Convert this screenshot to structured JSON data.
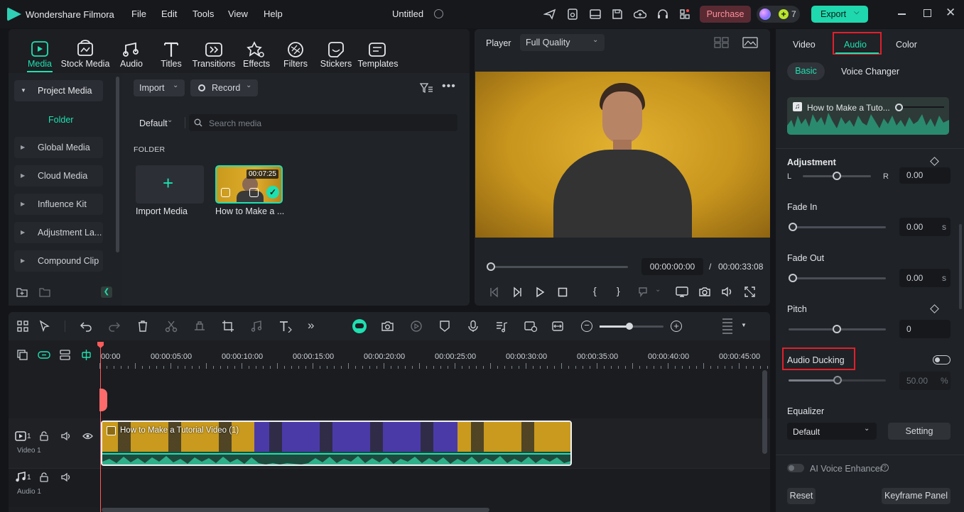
{
  "app": {
    "name": "Wondershare Filmora",
    "doc_title": "Untitled"
  },
  "menu": [
    "File",
    "Edit",
    "Tools",
    "View",
    "Help"
  ],
  "header": {
    "purchase": "Purchase",
    "credits": "7",
    "export": "Export"
  },
  "media_tabs": [
    {
      "label": "Media",
      "icon": "media-icon"
    },
    {
      "label": "Stock Media",
      "icon": "stock-media-icon"
    },
    {
      "label": "Audio",
      "icon": "audio-icon"
    },
    {
      "label": "Titles",
      "icon": "titles-icon"
    },
    {
      "label": "Transitions",
      "icon": "transitions-icon"
    },
    {
      "label": "Effects",
      "icon": "effects-icon"
    },
    {
      "label": "Filters",
      "icon": "filters-icon"
    },
    {
      "label": "Stickers",
      "icon": "stickers-icon"
    },
    {
      "label": "Templates",
      "icon": "templates-icon"
    }
  ],
  "sidebar": {
    "project_media": "Project Media",
    "folder": "Folder",
    "items": [
      "Global Media",
      "Cloud Media",
      "Influence Kit",
      "Adjustment La...",
      "Compound Clip"
    ]
  },
  "library": {
    "import": "Import",
    "record": "Record",
    "sort": "Default",
    "search_placeholder": "Search media",
    "folder_heading": "FOLDER",
    "import_media": "Import Media",
    "clip_name": "How to Make a ...",
    "clip_duration": "00:07:25"
  },
  "player": {
    "label": "Player",
    "quality": "Full Quality",
    "current_time": "00:00:00:00",
    "separator": "/",
    "total_time": "00:00:33:08"
  },
  "inspector": {
    "tabs": [
      "Video",
      "Audio",
      "Color"
    ],
    "active_tab": "Audio",
    "subtabs": [
      "Basic",
      "Voice Changer"
    ],
    "clip_name": "How to Make a Tuto...",
    "adjustment": "Adjustment",
    "balance": {
      "left": "L",
      "right": "R",
      "value": "0.00"
    },
    "fade_in": {
      "label": "Fade In",
      "value": "0.00",
      "unit": "s"
    },
    "fade_out": {
      "label": "Fade Out",
      "value": "0.00",
      "unit": "s"
    },
    "pitch": {
      "label": "Pitch",
      "value": "0"
    },
    "audio_ducking": {
      "label": "Audio Ducking",
      "value": "50.00",
      "unit": "%"
    },
    "equalizer": {
      "label": "Equalizer",
      "preset": "Default",
      "setting": "Setting"
    },
    "ai_voice": "AI Voice Enhancer",
    "reset": "Reset",
    "keyframe_panel": "Keyframe Panel"
  },
  "timeline": {
    "ruler": [
      "00:00",
      "00:00:05:00",
      "00:00:10:00",
      "00:00:15:00",
      "00:00:20:00",
      "00:00:25:00",
      "00:00:30:00",
      "00:00:35:00",
      "00:00:40:00",
      "00:00:45:00"
    ],
    "video_track": {
      "number": "1",
      "name": "Video 1"
    },
    "audio_track": {
      "number": "1",
      "name": "Audio 1"
    },
    "clip_title": "How to Make a Tutorial Video (1)"
  },
  "colors": {
    "accent": "#1ee0b0",
    "export": "#1fd8ad",
    "purchase": "#5a2a33",
    "highlight": "#e0202c"
  }
}
